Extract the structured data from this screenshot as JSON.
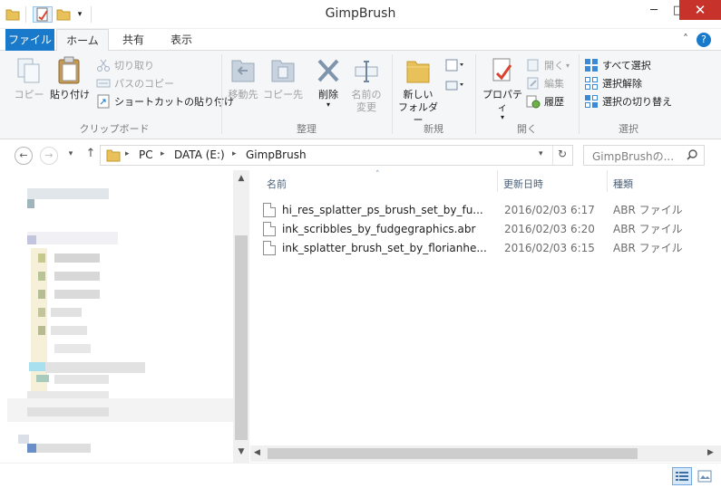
{
  "window": {
    "title": "GimpBrush",
    "minimize": "─",
    "maximize": "□",
    "close": "✕"
  },
  "ribbon_tabs": {
    "file": "ファイル",
    "home": "ホーム",
    "share": "共有",
    "view": "表示"
  },
  "ribbon": {
    "clipboard": {
      "label": "クリップボード",
      "copy": "コピー",
      "paste": "貼り付け",
      "cut": "切り取り",
      "copy_path": "パスのコピー",
      "paste_shortcut": "ショートカットの貼り付け"
    },
    "organize": {
      "label": "整理",
      "move_to": "移動先",
      "copy_to": "コピー先",
      "delete": "削除",
      "rename_line1": "名前の",
      "rename_line2": "変更"
    },
    "new": {
      "label": "新規",
      "new_folder_line1": "新しい",
      "new_folder_line2": "フォルダー"
    },
    "open": {
      "label": "開く",
      "properties": "プロパティ",
      "open": "開く",
      "edit": "編集",
      "history": "履歴"
    },
    "select": {
      "label": "選択",
      "select_all": "すべて選択",
      "select_none": "選択解除",
      "invert": "選択の切り替え"
    }
  },
  "address": {
    "path": [
      "PC",
      "DATA (E:)",
      "GimpBrush"
    ],
    "search_placeholder": "GimpBrushの..."
  },
  "columns": {
    "name": "名前",
    "date": "更新日時",
    "type": "種類"
  },
  "files": [
    {
      "name": "hi_res_splatter_ps_brush_set_by_fu...",
      "date": "2016/02/03 6:17",
      "type": "ABR ファイル"
    },
    {
      "name": "ink_scribbles_by_fudgegraphics.abr",
      "date": "2016/02/03 6:20",
      "type": "ABR ファイル"
    },
    {
      "name": "ink_splatter_brush_set_by_florianhe...",
      "date": "2016/02/03 6:15",
      "type": "ABR ファイル"
    }
  ],
  "colors": {
    "accent": "#1979ca",
    "close": "#c7332b",
    "folder": "#e8c15a"
  }
}
